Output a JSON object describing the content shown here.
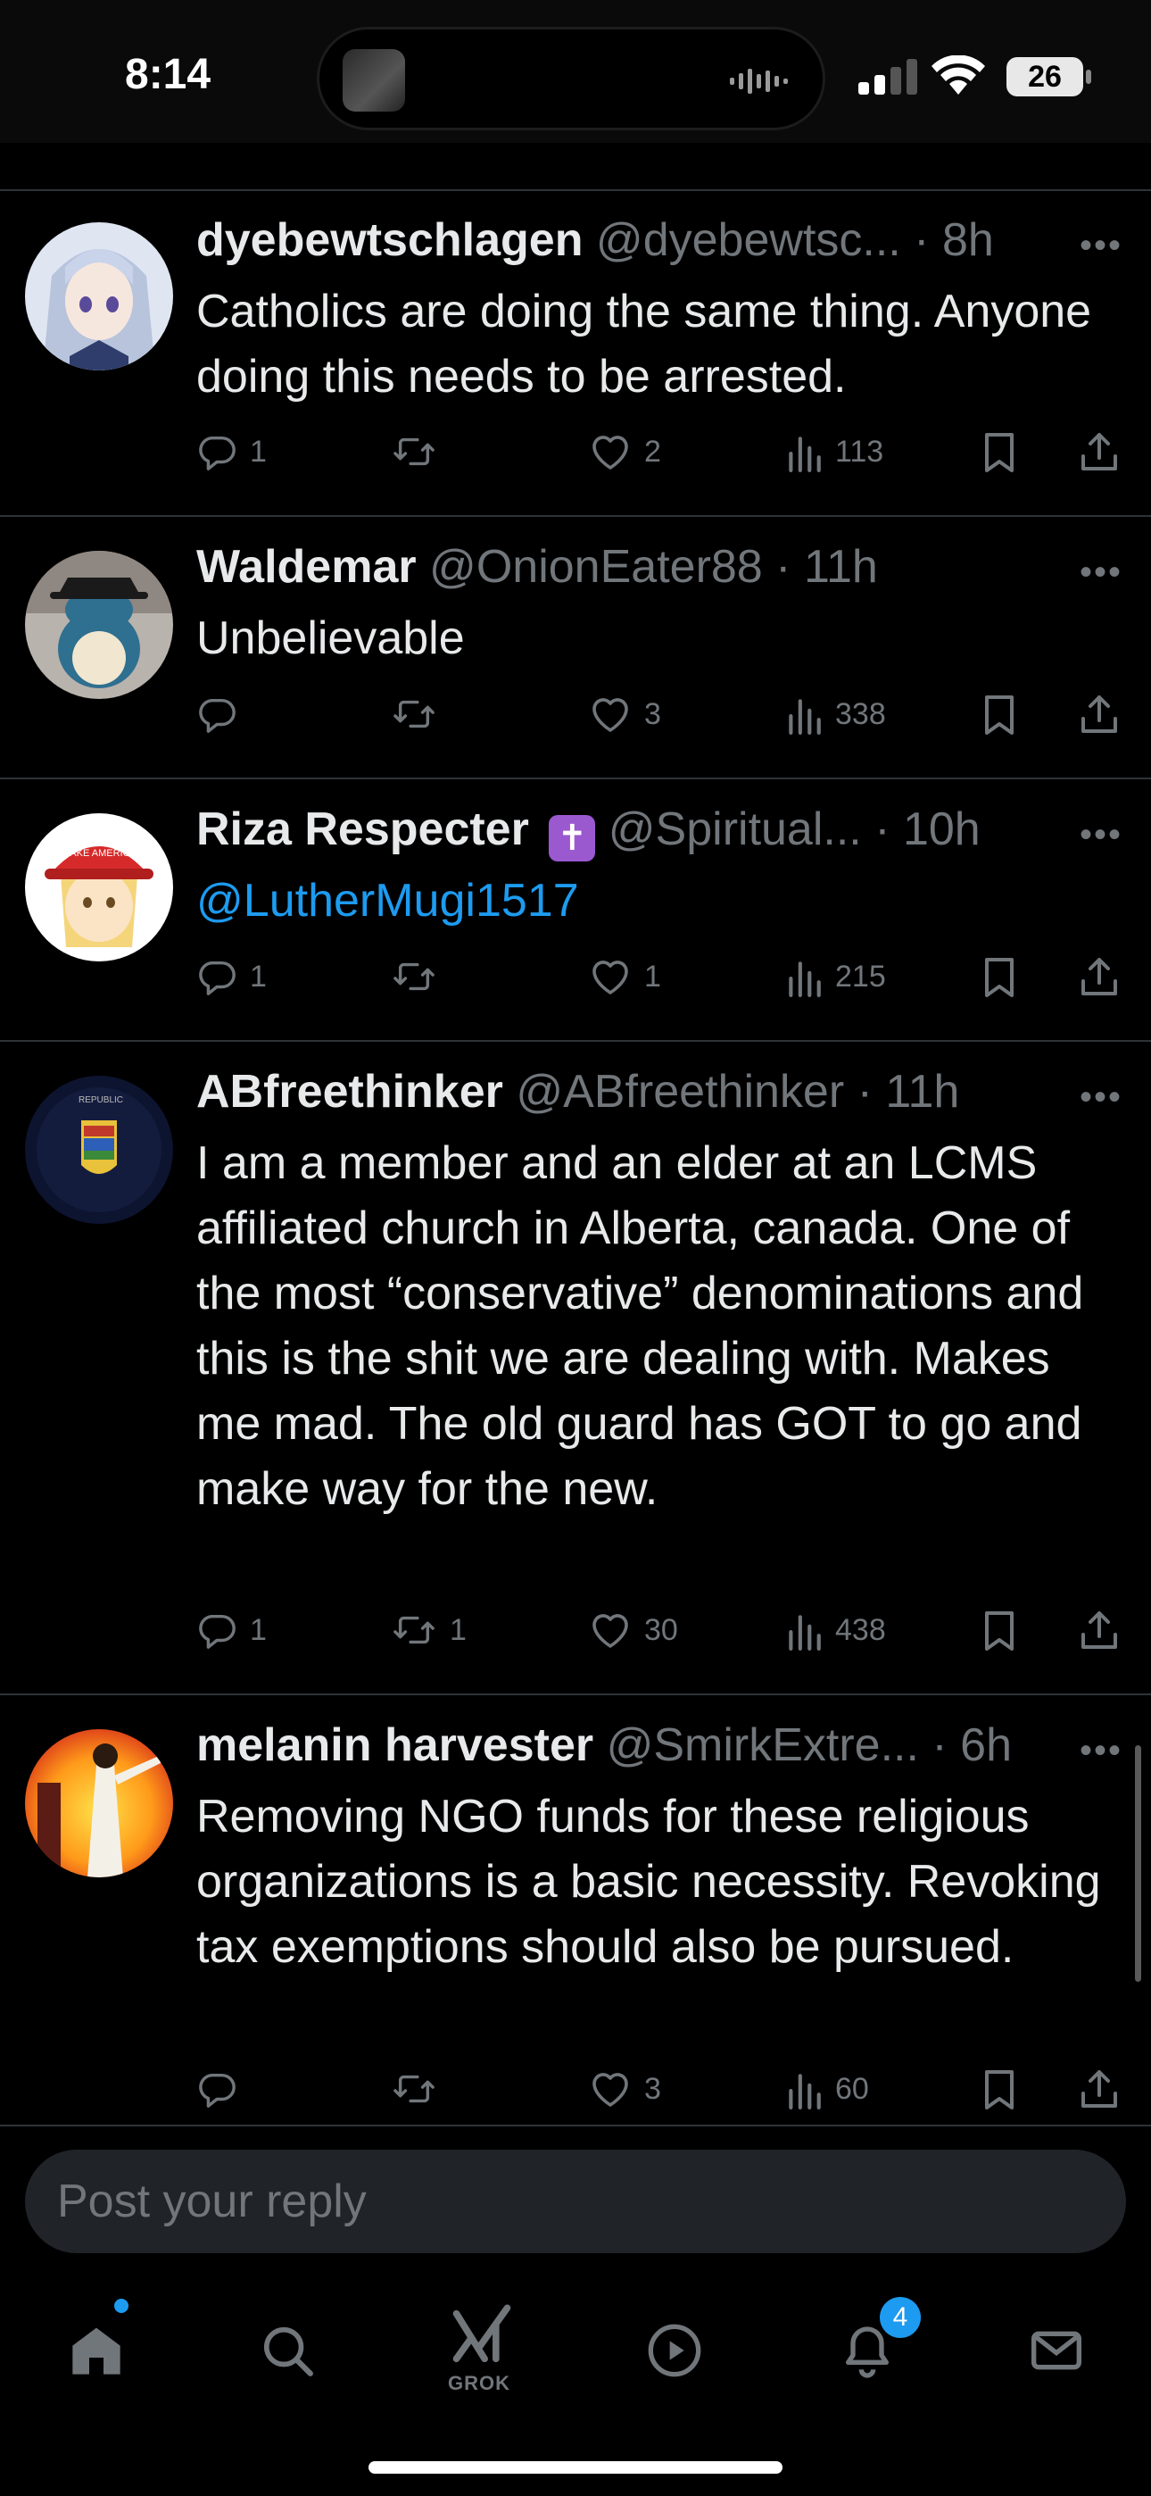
{
  "status_bar": {
    "time": "8:14",
    "battery": "26"
  },
  "tweets": [
    {
      "name": "dyebewtschlagen",
      "handle": "@dyebewtsc...",
      "time": "8h",
      "text": "Catholics are doing the same thing. Anyone doing this needs to be arrested.",
      "replies": "1",
      "reposts": "",
      "likes": "2",
      "views": "113"
    },
    {
      "name": "Waldemar",
      "handle": "@OnionEater88",
      "time": "11h",
      "text": "Unbelievable",
      "replies": "",
      "reposts": "",
      "likes": "3",
      "views": "338"
    },
    {
      "name": "Riza Respecter",
      "badge": "✝",
      "handle": "@Spiritual...",
      "time": "10h",
      "text": "@LutherMugi1517",
      "replies": "1",
      "reposts": "",
      "likes": "1",
      "views": "215"
    },
    {
      "name": "ABfreethinker",
      "handle": "@ABfreethinker",
      "time": "11h",
      "text": "I am a member and an elder at an LCMS affiliated church in Alberta, canada. One of the most “conservative” denominations and this is the shit we are dealing with. Makes me mad. The old guard has GOT to go and make way for the new.",
      "replies": "1",
      "reposts": "1",
      "likes": "30",
      "views": "438"
    },
    {
      "name": "melanin harvester",
      "handle": "@SmirkExtre...",
      "time": "6h",
      "text": "Removing NGO funds for these religious organizations is a basic necessity. Revoking tax exemptions should also be pursued.",
      "replies": "",
      "reposts": "",
      "likes": "3",
      "views": "60"
    }
  ],
  "reply_bar": {
    "placeholder": "Post your reply"
  },
  "tabbar": {
    "grok_label": "GROK",
    "notifications_count": "4",
    "icons": [
      "home-icon",
      "search-icon",
      "grok-icon",
      "video-icon",
      "bell-icon",
      "mail-icon"
    ]
  },
  "colors": {
    "accent": "#1d9bf0",
    "background": "#000000",
    "secondary_text": "#71767b",
    "divider": "#2f3336"
  }
}
